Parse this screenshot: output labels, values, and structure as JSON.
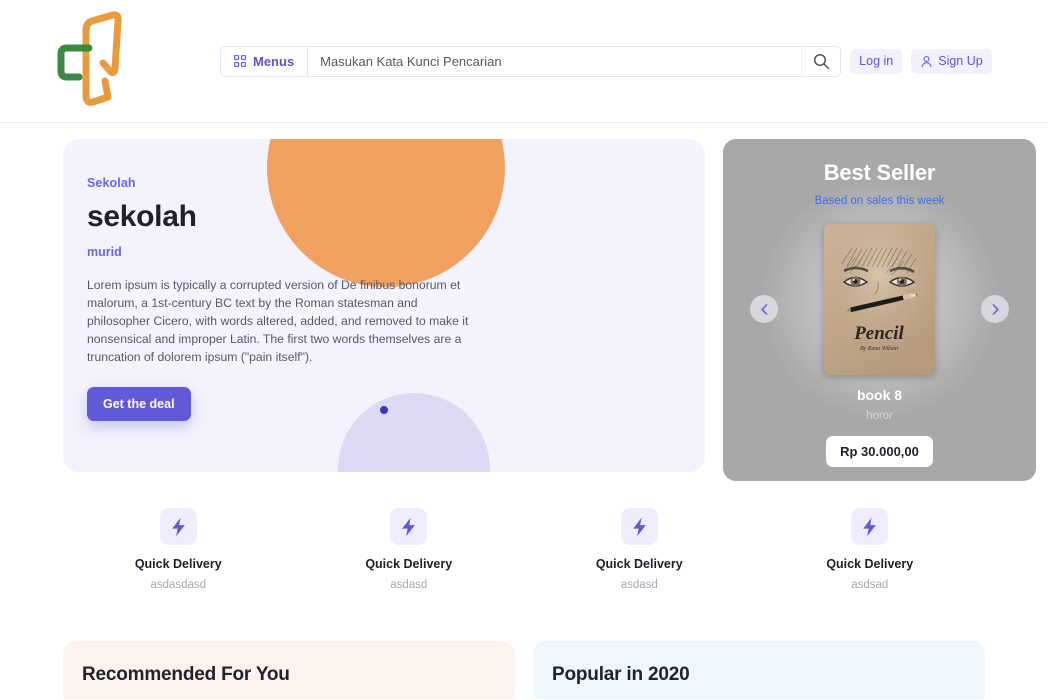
{
  "header": {
    "logo_name": "bookstore-logo",
    "menus_label": "Menus",
    "search": {
      "value": "",
      "placeholder": "Masukan Kata Kunci Pencarian"
    },
    "login_label": "Log in",
    "signup_label": "Sign Up"
  },
  "hero": {
    "eyebrow": "Sekolah",
    "title": "sekolah",
    "subtitle": "murid",
    "body": "Lorem ipsum is typically a corrupted version of De finibus bonorum et malorum, a 1st-century BC text by the Roman statesman and philosopher Cicero, with words altered, added, and removed to make it nonsensical and improper Latin. The first two words themselves are a truncation of dolorem ipsum (\"pain itself\").",
    "cta_label": "Get the deal"
  },
  "best_seller": {
    "title": "Best Seller",
    "subtitle": "Based on sales this week",
    "book": {
      "cover_title": "Pencil",
      "cover_author": "By Rena Wilson",
      "name": "book 8",
      "genre": "horor",
      "price": "Rp 30.000,00"
    },
    "prev_label": "‹",
    "next_label": "›"
  },
  "features": [
    {
      "title": "Quick Delivery",
      "desc": "asdasdasd"
    },
    {
      "title": "Quick Delivery",
      "desc": "asdasd"
    },
    {
      "title": "Quick Delivery",
      "desc": "asdasd"
    },
    {
      "title": "Quick Delivery",
      "desc": "asdsad"
    }
  ],
  "panels": {
    "recommended_title": "Recommended For You",
    "popular_title": "Popular in 2020"
  },
  "colors": {
    "accent_purple": "#6259d8",
    "accent_light": "#f1f0fc",
    "hero_bg": "#f3f3fd",
    "orange": "#f0a160",
    "recommended_bg": "#fdf3ee",
    "popular_bg": "#eff6fd",
    "logo_orange": "#e89b3c",
    "logo_green": "#3b8a3f"
  }
}
